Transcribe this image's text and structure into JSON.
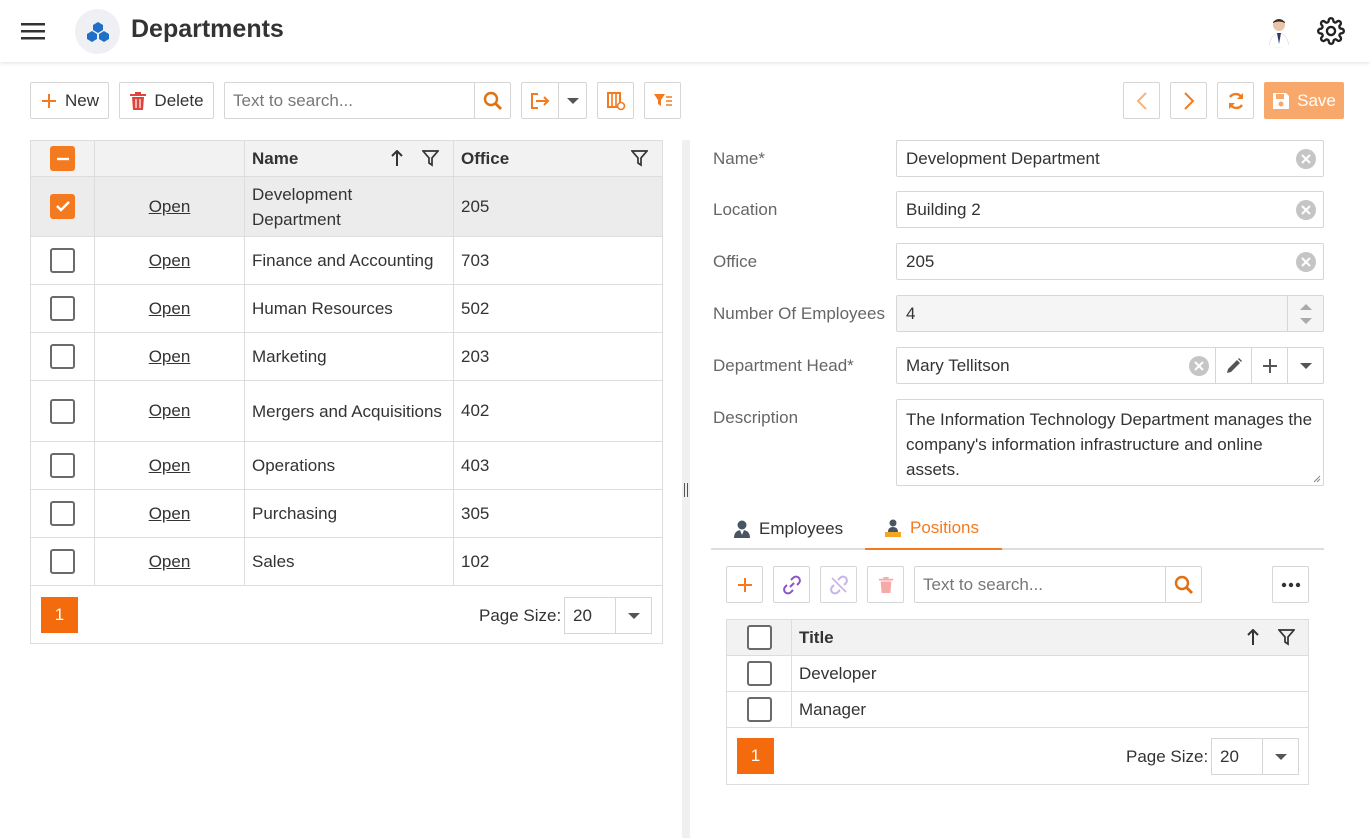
{
  "header": {
    "title": "Departments",
    "menu_icon": "hamburger-icon",
    "logo_icon": "app-logo-icon",
    "avatar_icon": "user-avatar-icon",
    "settings_icon": "gear-icon"
  },
  "toolbar": {
    "new_label": "New",
    "delete_label": "Delete",
    "search_placeholder": "Text to search...",
    "save_label": "Save"
  },
  "grid": {
    "columns": [
      "Name",
      "Office"
    ],
    "open_label": "Open",
    "rows": [
      {
        "name": "Development Department",
        "office": "205",
        "selected": true
      },
      {
        "name": "Finance and Accounting",
        "office": "703",
        "selected": false
      },
      {
        "name": "Human Resources",
        "office": "502",
        "selected": false
      },
      {
        "name": "Marketing",
        "office": "203",
        "selected": false
      },
      {
        "name": "Mergers and Acquisitions",
        "office": "402",
        "selected": false
      },
      {
        "name": "Operations",
        "office": "403",
        "selected": false
      },
      {
        "name": "Purchasing",
        "office": "305",
        "selected": false
      },
      {
        "name": "Sales",
        "office": "102",
        "selected": false
      }
    ],
    "page": "1",
    "page_size_label": "Page Size:",
    "page_size": "20"
  },
  "form": {
    "name_label": "Name*",
    "name_value": "Development Department",
    "location_label": "Location",
    "location_value": "Building 2",
    "office_label": "Office",
    "office_value": "205",
    "employees_label": "Number Of Employees",
    "employees_value": "4",
    "head_label": "Department Head*",
    "head_value": "Mary Tellitson",
    "description_label": "Description",
    "description_value": "The Information Technology Department manages the company's information infrastructure and online assets."
  },
  "tabs": {
    "employees_label": "Employees",
    "positions_label": "Positions",
    "active": "Positions"
  },
  "positions": {
    "search_placeholder": "Text to search...",
    "column": "Title",
    "rows": [
      "Developer",
      "Manager"
    ],
    "page": "1",
    "page_size_label": "Page Size:",
    "page_size": "20"
  },
  "colors": {
    "accent": "#f47a20",
    "pager": "#f46b0d",
    "save_disabled": "#f8a86a",
    "link_purple": "#8a55c9"
  }
}
